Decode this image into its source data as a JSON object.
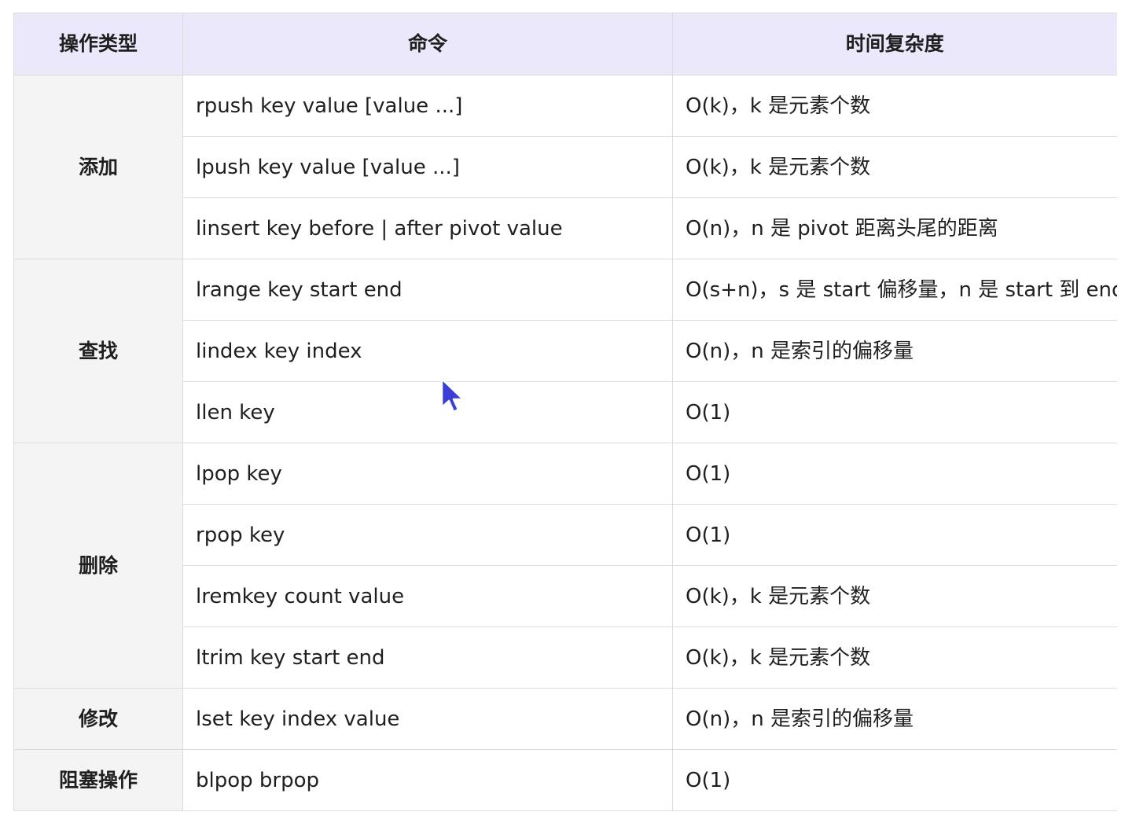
{
  "headers": [
    "操作类型",
    "命令",
    "时间复杂度"
  ],
  "groups": [
    {
      "name": "添加",
      "rows": [
        {
          "command": "rpush key value [value ...]",
          "complexity": "O(k)，k 是元素个数"
        },
        {
          "command": "lpush key value [value ...]",
          "complexity": "O(k)，k 是元素个数"
        },
        {
          "command": "linsert key before | after pivot value",
          "complexity": "O(n)，n 是 pivot 距离头尾的距离"
        }
      ]
    },
    {
      "name": "查找",
      "rows": [
        {
          "command": "lrange key start end",
          "complexity": "O(s+n)，s 是 start 偏移量，n 是 start 到 end"
        },
        {
          "command": "lindex key index",
          "complexity": "O(n)，n 是索引的偏移量"
        },
        {
          "command": "llen key",
          "complexity": "O(1)"
        }
      ]
    },
    {
      "name": "删除",
      "rows": [
        {
          "command": "lpop key",
          "complexity": "O(1)"
        },
        {
          "command": "rpop key",
          "complexity": "O(1)"
        },
        {
          "command": "lremkey count value",
          "complexity": "O(k)，k 是元素个数"
        },
        {
          "command": "ltrim key start end",
          "complexity": "O(k)，k 是元素个数"
        }
      ]
    },
    {
      "name": "修改",
      "rows": [
        {
          "command": "lset key index value",
          "complexity": "O(n)，n 是索引的偏移量"
        }
      ]
    },
    {
      "name": "阻塞操作",
      "rows": [
        {
          "command": "blpop brpop",
          "complexity": "O(1)"
        }
      ]
    }
  ],
  "colors": {
    "header_bg": "#ece8fc",
    "group_bg": "#f4f4f5",
    "border": "#dcdcdc",
    "cursor": "#3b3fd8"
  },
  "cursor_icon": "arrow-pointer-icon"
}
